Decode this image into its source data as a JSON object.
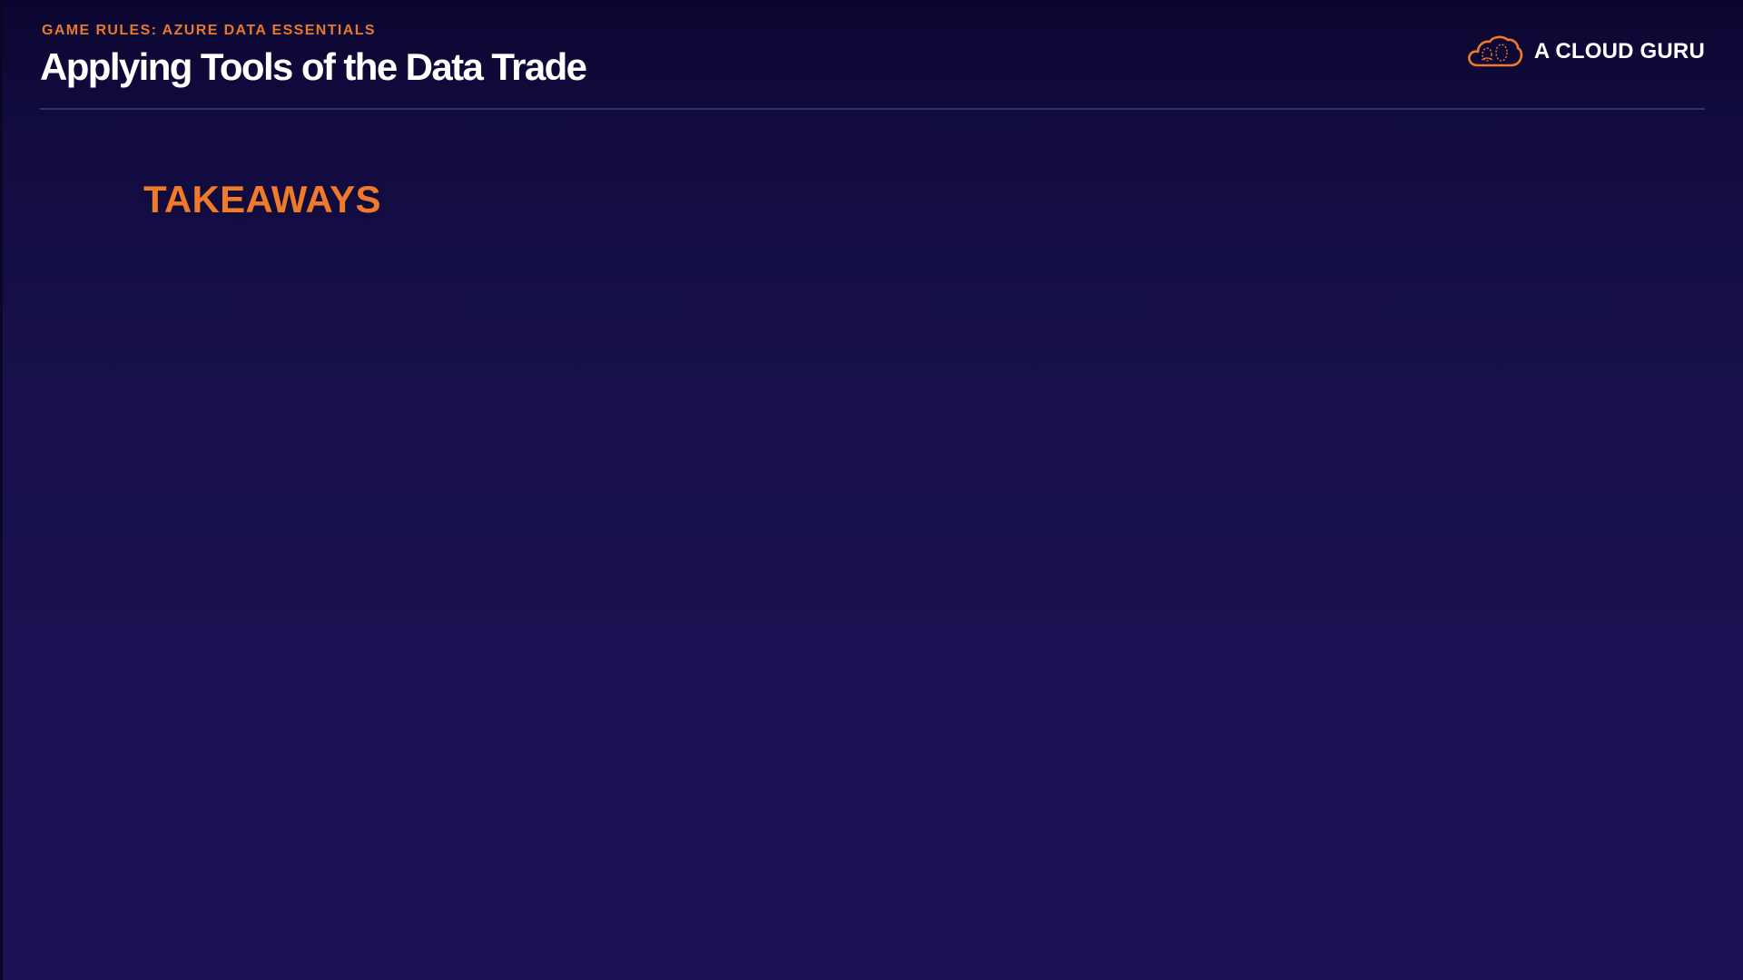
{
  "header": {
    "kicker": "GAME RULES: AZURE DATA ESSENTIALS",
    "title": "Applying Tools of the Data Trade"
  },
  "brand": {
    "name": "A CLOUD GURU",
    "icon": "cloud-logo-icon"
  },
  "main": {
    "heading": "TAKEAWAYS"
  },
  "colors": {
    "accent": "#ef7a2c",
    "background": "#1b1254",
    "text": "#ffffff"
  }
}
